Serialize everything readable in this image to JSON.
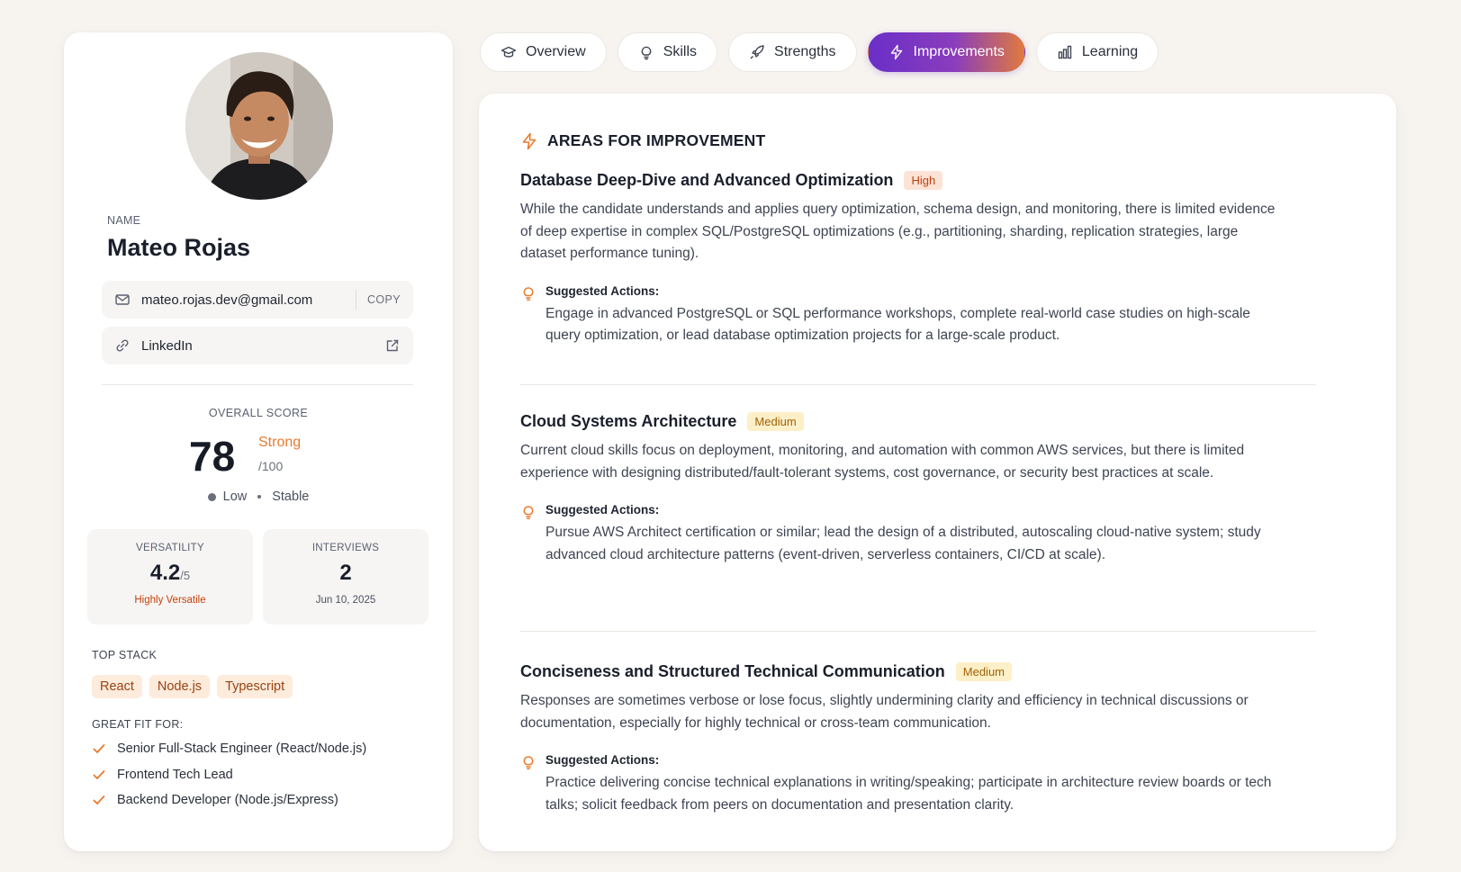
{
  "profile": {
    "name_label": "NAME",
    "name": "Mateo Rojas",
    "email": "mateo.rojas.dev@gmail.com",
    "copy_label": "COPY",
    "linkedin_label": "LinkedIn",
    "score_label": "OVERALL SCORE",
    "score": "78",
    "score_tier": "Strong",
    "score_max": "/100",
    "score_risk": "Low",
    "score_trend": "Stable",
    "versatility": {
      "label": "VERSATILITY",
      "value": "4.2",
      "max": "/5",
      "sub": "Highly Versatile",
      "sub_color": "#c2410c"
    },
    "interviews": {
      "label": "INTERVIEWS",
      "value": "2",
      "sub": "Jun 10, 2025"
    },
    "top_stack_label": "TOP STACK",
    "top_stack": [
      "React",
      "Node.js",
      "Typescript"
    ],
    "great_fit_label": "GREAT FIT FOR:",
    "great_fit": [
      "Senior Full-Stack Engineer (React/Node.js)",
      "Frontend Tech Lead",
      "Backend Developer (Node.js/Express)"
    ]
  },
  "tabs": [
    {
      "label": "Overview",
      "icon": "graduation-cap-icon",
      "active": false
    },
    {
      "label": "Skills",
      "icon": "lightbulb-icon",
      "active": false
    },
    {
      "label": "Strengths",
      "icon": "rocket-icon",
      "active": false
    },
    {
      "label": "Improvements",
      "icon": "lightning-icon",
      "active": true
    },
    {
      "label": "Learning",
      "icon": "bar-chart-icon",
      "active": false
    }
  ],
  "panel": {
    "header": "AREAS FOR IMPROVEMENT",
    "accent": "#ea7a2c",
    "actions_label": "Suggested Actions:",
    "items": [
      {
        "title": "Database Deep-Dive and Advanced Optimization",
        "priority": "High",
        "description": "While the candidate understands and applies query optimization, schema design, and monitoring, there is limited evidence of deep expertise in complex SQL/PostgreSQL optimizations (e.g., partitioning, sharding, replication strategies, large dataset performance tuning).",
        "actions": "Engage in advanced PostgreSQL or SQL performance workshops, complete real-world case studies on high-scale query optimization, or lead database optimization projects for a large-scale product."
      },
      {
        "title": "Cloud Systems Architecture",
        "priority": "Medium",
        "description": "Current cloud skills focus on deployment, monitoring, and automation with common AWS services, but there is limited experience with designing distributed/fault-tolerant systems, cost governance, or security best practices at scale.",
        "actions": "Pursue AWS Architect certification or similar; lead the design of a distributed, autoscaling cloud-native system; study advanced cloud architecture patterns (event-driven, serverless containers, CI/CD at scale)."
      },
      {
        "title": "Conciseness and Structured Technical Communication",
        "priority": "Medium",
        "description": "Responses are sometimes verbose or lose focus, slightly undermining clarity and efficiency in technical discussions or documentation, especially for highly technical or cross-team communication.",
        "actions": "Practice delivering concise technical explanations in writing/speaking; participate in architecture review boards or tech talks; solicit feedback from peers on documentation and presentation clarity."
      }
    ]
  }
}
